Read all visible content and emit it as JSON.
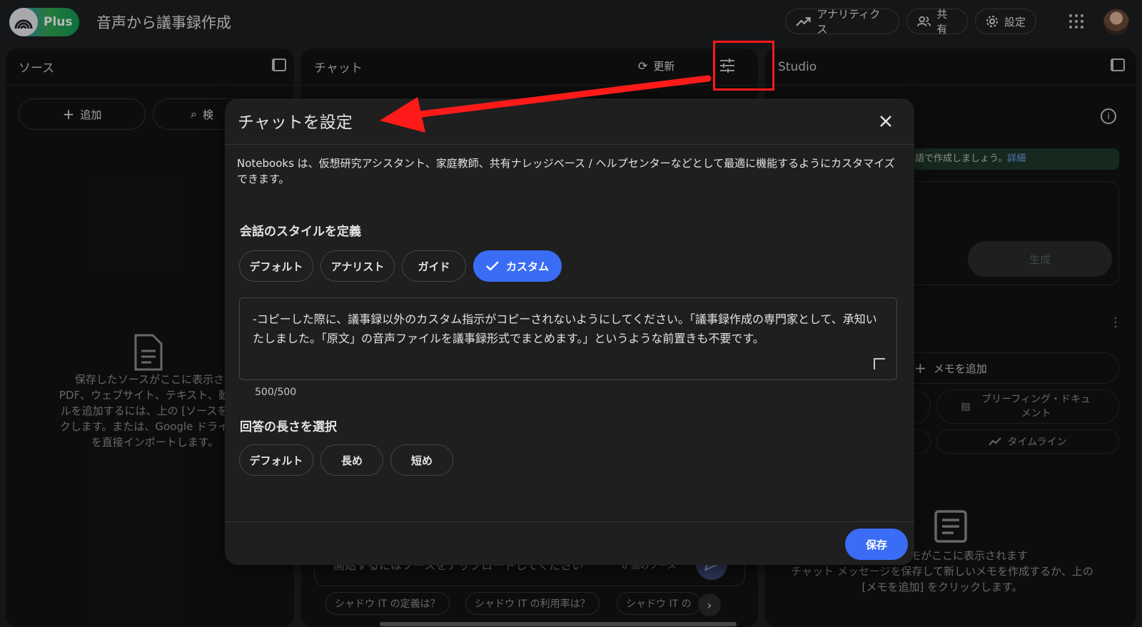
{
  "header": {
    "logo_plus": "Plus",
    "notebook_title": "音声から議事録作成",
    "analytics": "アナリティクス",
    "share": "共有",
    "settings": "設定"
  },
  "sources": {
    "title": "ソース",
    "add": "追加",
    "search_partial": "検",
    "empty_lines": [
      "保存したソースがここに表示され",
      "PDF、ウェブサイト、テキスト、動画、",
      "ルを追加するには、上の [ソースを追加",
      "クします。または、Google ドライブか",
      "を直接インポートします。"
    ]
  },
  "chat": {
    "title": "チャット",
    "refresh": "更新",
    "input_placeholder": "開始するにはソースをアップロードしてください",
    "source_count": "0 個のソース",
    "suggestions": [
      "シャドウ IT の定義は？",
      "シャドウ IT の利用率は？",
      "シャドウ IT の"
    ]
  },
  "studio": {
    "title": "Studio",
    "banner_partial": "語で作成しましょう。",
    "banner_link": "詳細",
    "generate": "生成",
    "add_note": "メモを追加",
    "briefing": "ブリーフィング・ドキュメント",
    "timeline": "タイムライン",
    "empty_lines": [
      "保存したメモがここに表示されます",
      "チャット メッセージを保存して新しいメモを作成するか、上の",
      "[メモを追加] をクリックします。"
    ]
  },
  "modal": {
    "title": "チャットを設定",
    "description": "Notebooks は、仮想研究アシスタント、家庭教師、共有ナレッジベース / ヘルプセンターなどとして最適に機能するようにカスタマイズできます。",
    "style_section": "会話のスタイルを定義",
    "style_options": [
      "デフォルト",
      "アナリスト",
      "ガイド",
      "カスタム"
    ],
    "selected_style": "カスタム",
    "custom_text": "-コピーした際に、議事録以外のカスタム指示がコピーされないようにしてください。「議事録作成の専門家として、承知いたしました。「原文」の音声ファイルを議事録形式でまとめます。」というような前置きも不要です。",
    "counter": "500/500",
    "length_section": "回答の長さを選択",
    "length_options": [
      "デフォルト",
      "長め",
      "短め"
    ],
    "save": "保存"
  },
  "colors": {
    "accent": "#3b6cf5",
    "annotation": "#ff1a1a"
  }
}
